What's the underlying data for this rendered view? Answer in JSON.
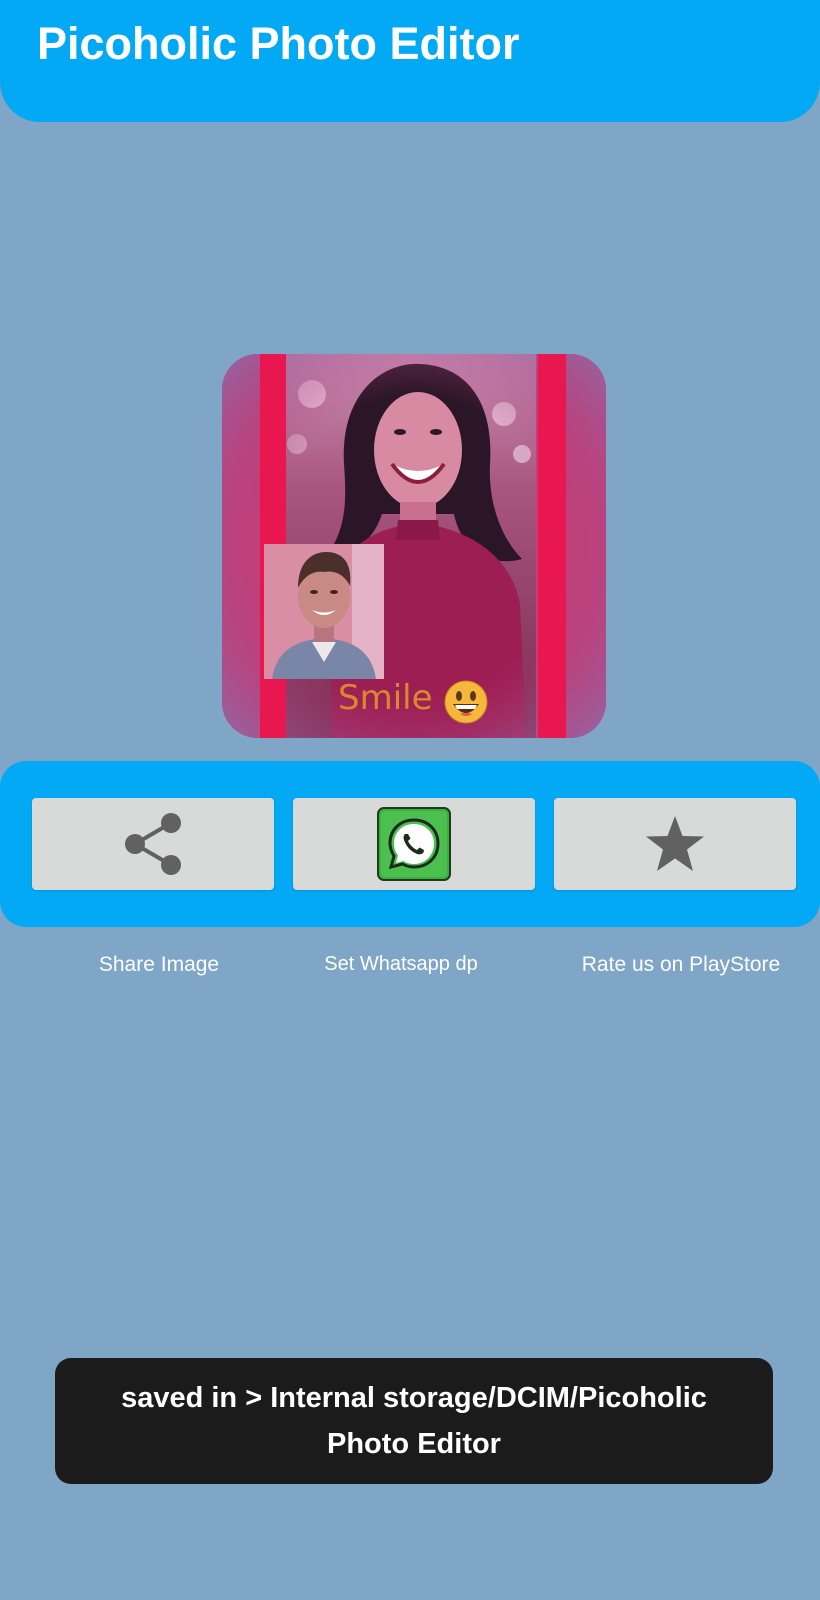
{
  "app_bar": {
    "title": "Picoholic Photo Editor",
    "color": "#03a9f4"
  },
  "preview": {
    "sticker_text": "Smile",
    "sticker_emoji_icon": "grinning-face-icon",
    "frame_color": "#e8174f"
  },
  "actions": [
    {
      "label": "Share Image",
      "icon": "share-icon"
    },
    {
      "label": "Set Whatsapp dp",
      "icon": "whatsapp-icon"
    },
    {
      "label": "Rate us on PlayStore",
      "icon": "star-icon"
    }
  ],
  "toast": {
    "message": "saved in > Internal storage/DCIM/Picoholic Photo Editor"
  },
  "colors": {
    "background": "#7fa5c7",
    "accent": "#03a9f4",
    "button": "#d8dada",
    "icon": "#616161",
    "toast": "#1b1b1b"
  }
}
